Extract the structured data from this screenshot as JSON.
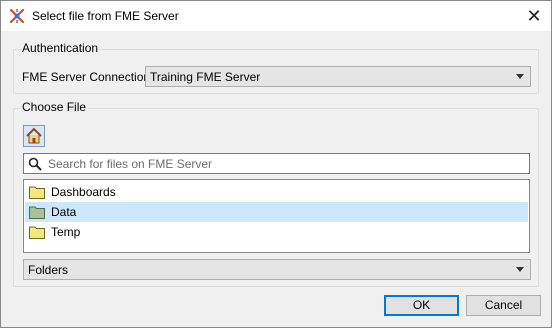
{
  "window": {
    "title": "Select file from FME Server",
    "close_label": "✕"
  },
  "authentication": {
    "group_title": "Authentication",
    "connection_label": "FME Server Connection:",
    "connection_value": "Training FME Server"
  },
  "choose_file": {
    "group_title": "Choose File",
    "search_placeholder": "Search for files on FME Server",
    "items": [
      {
        "label": "Dashboards",
        "selected": false,
        "icon": "folder-icon"
      },
      {
        "label": "Data",
        "selected": true,
        "icon": "folder-open-icon"
      },
      {
        "label": "Temp",
        "selected": false,
        "icon": "folder-icon"
      }
    ],
    "filter_value": "Folders"
  },
  "buttons": {
    "ok": "OK",
    "cancel": "Cancel"
  },
  "colors": {
    "selection": "#cce8ff",
    "accent": "#0078d7",
    "folder": "#e6d36a"
  }
}
